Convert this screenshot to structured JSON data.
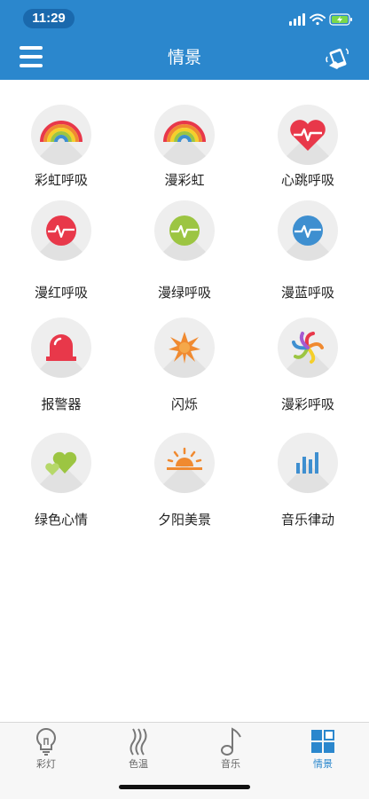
{
  "status_bar": {
    "time": "11:29"
  },
  "header": {
    "title": "情景"
  },
  "colors": {
    "header": "#2b87cd",
    "active": "#2b87cd",
    "red": "#e8384a",
    "green": "#9cc542",
    "blue": "#3e8fd0",
    "orange": "#f08a30"
  },
  "scenes": [
    {
      "label": "彩虹呼吸",
      "icon": "rainbow-icon"
    },
    {
      "label": "漫彩虹",
      "icon": "rainbow-icon"
    },
    {
      "label": "心跳呼吸",
      "icon": "heartbeat-icon"
    },
    {
      "label": "漫红呼吸",
      "icon": "pulse-red-icon"
    },
    {
      "label": "漫绿呼吸",
      "icon": "pulse-green-icon"
    },
    {
      "label": "漫蓝呼吸",
      "icon": "pulse-blue-icon"
    },
    {
      "label": "报警器",
      "icon": "alarm-light-icon"
    },
    {
      "label": "闪烁",
      "icon": "flash-star-icon"
    },
    {
      "label": "漫彩呼吸",
      "icon": "color-swirl-icon"
    },
    {
      "label": "绿色心情",
      "icon": "green-hearts-icon"
    },
    {
      "label": "夕阳美景",
      "icon": "sunset-icon"
    },
    {
      "label": "音乐律动",
      "icon": "music-bars-icon"
    }
  ],
  "tabs": [
    {
      "label": "彩灯",
      "icon": "bulb-icon"
    },
    {
      "label": "色温",
      "icon": "heat-waves-icon"
    },
    {
      "label": "音乐",
      "icon": "music-note-icon"
    },
    {
      "label": "情景",
      "icon": "scene-grid-icon",
      "active": true
    }
  ]
}
